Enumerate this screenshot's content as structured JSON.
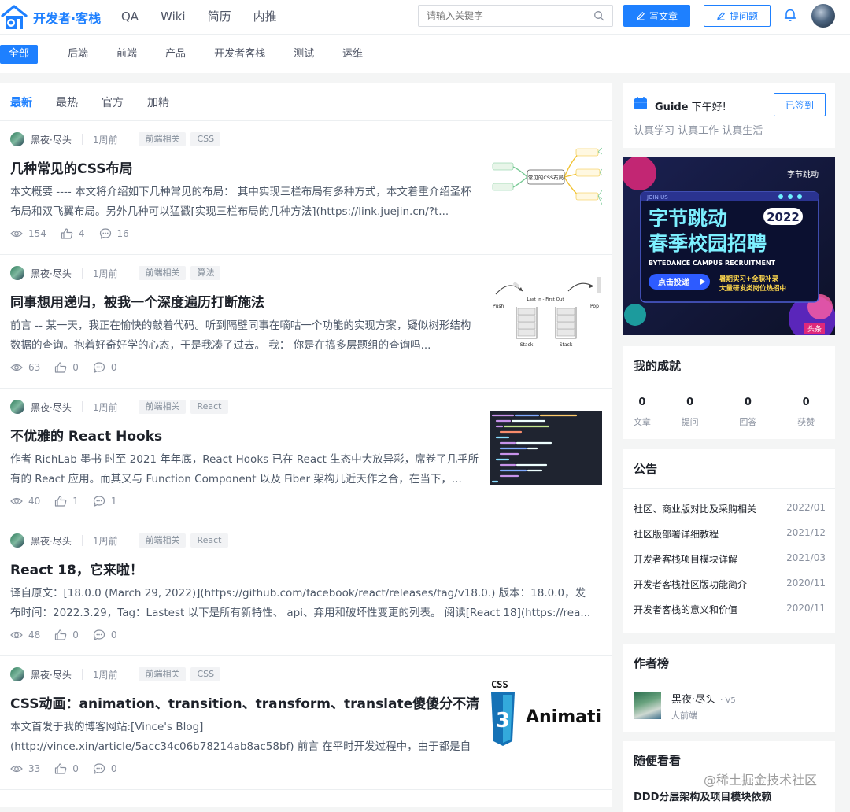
{
  "brand": {
    "name": "开发者·客栈",
    "accent": "#1e80ff"
  },
  "nav": [
    "QA",
    "Wiki",
    "简历",
    "内推"
  ],
  "search": {
    "placeholder": "请输入关键字"
  },
  "header_buttons": {
    "write": "写文章",
    "ask": "提问题"
  },
  "categories": [
    "全部",
    "后端",
    "前端",
    "产品",
    "开发者客栈",
    "测试",
    "运维"
  ],
  "feed_tabs": [
    "最新",
    "最热",
    "官方",
    "加精"
  ],
  "articles": [
    {
      "author": "黑夜·尽头",
      "time": "1周前",
      "tags": [
        "前端相关",
        "CSS"
      ],
      "title": "几种常见的CSS布局",
      "summary": "本文概要 ---- 本文将介绍如下几种常见的布局： 其中实现三栏布局有多种方式，本文着重介绍圣杯布局和双飞翼布局。另外几种可以猛戳[实现三栏布局的几种方法](https://link.juejin.cn/?t...",
      "views": "154",
      "likes": "4",
      "comments": "16",
      "thumb": {
        "center": "常见的CSS布局"
      }
    },
    {
      "author": "黑夜·尽头",
      "time": "1周前",
      "tags": [
        "前端相关",
        "算法"
      ],
      "title": "同事想用递归，被我一个深度遍历打断施法",
      "summary": "前言 -- 某一天，我正在愉快的敲着代码。听到隔壁同事在嘀咕一个功能的实现方案，疑似树形结构数据的查询。抱着好奇好学的心态，于是我凑了过去。 我： 你是在搞多层题组的查询吗...",
      "views": "63",
      "likes": "0",
      "comments": "0",
      "thumb": {
        "push": "Push",
        "pop": "Pop",
        "lifo": "Last In - First Out",
        "stack": "Stack"
      }
    },
    {
      "author": "黑夜·尽头",
      "time": "1周前",
      "tags": [
        "前端相关",
        "React"
      ],
      "title": "不优雅的 React Hooks",
      "summary": "作者 RichLab 墨书 时至 2021 年年底，React Hooks 已在 React 生态中大放异彩，席卷了几乎所有的 React 应用。而其又与 Function Component 以及 Fiber 架构几近天作之合，在当下，...",
      "views": "40",
      "likes": "1",
      "comments": "1"
    },
    {
      "author": "黑夜·尽头",
      "time": "1周前",
      "tags": [
        "前端相关",
        "React"
      ],
      "title": "React 18，它来啦！",
      "summary": "译自原文：[18.0.0 (March 29, 2022)](https://github.com/facebook/react/releases/tag/v18.0.) 版本：18.0.0，发布时间：2022.3.29，Tag：Lastest 以下是所有新特性、 api、弃用和破坏性变更的列表。 阅读[React 18](https://rea...",
      "views": "48",
      "likes": "0",
      "comments": "0"
    },
    {
      "author": "黑夜·尽头",
      "time": "1周前",
      "tags": [
        "前端相关",
        "CSS"
      ],
      "title": "CSS动画：animation、transition、transform、translate傻傻分不清",
      "summary": "本文首发于我的博客网站:[Vince's Blog](http://vince.xin/article/5acc34c06b78214ab8ac58bf) 前言 在平时开发过程中，由于都是自己捣鼓玩的项目，并没有UI设计给我的设计图，更没有...",
      "views": "33",
      "likes": "0",
      "comments": "0",
      "thumb": {
        "css": "CSS",
        "word": "Animatio"
      }
    }
  ],
  "greeting": {
    "name": "Guide",
    "hello": "下午好!",
    "motto": "认真学习 认真工作 认真生活",
    "signed": "已签到"
  },
  "banner": {
    "brand": "字节跳动",
    "join": "JOIN US",
    "line1": "字节跳动",
    "year": "2022",
    "line2": "春季校园招聘",
    "sub": "BYTEDANCE CAMPUS RECRUITMENT",
    "cta": "点击投递",
    "perks1": "暑期实习+全职补录",
    "perks2": "大量研发类岗位热招中",
    "corner": "头条"
  },
  "achievements": {
    "title": "我的成就",
    "items": [
      {
        "value": "0",
        "label": "文章"
      },
      {
        "value": "0",
        "label": "提问"
      },
      {
        "value": "0",
        "label": "回答"
      },
      {
        "value": "0",
        "label": "获赞"
      }
    ]
  },
  "notices": {
    "title": "公告",
    "items": [
      {
        "title": "社区、商业版对比及采购相关",
        "date": "2022/01"
      },
      {
        "title": "社区版部署详细教程",
        "date": "2021/12"
      },
      {
        "title": "开发者客栈项目模块详解",
        "date": "2021/03"
      },
      {
        "title": "开发者客栈社区版功能简介",
        "date": "2020/11"
      },
      {
        "title": "开发者客栈的意义和价值",
        "date": "2020/11"
      }
    ]
  },
  "author_rank": {
    "title": "作者榜",
    "name": "黑夜·尽头",
    "level": "· V5",
    "role": "大前端"
  },
  "random": {
    "title": "随便看看",
    "first": "DDD分层架构及项目模块依赖"
  },
  "watermark": "@稀土掘金技术社区"
}
